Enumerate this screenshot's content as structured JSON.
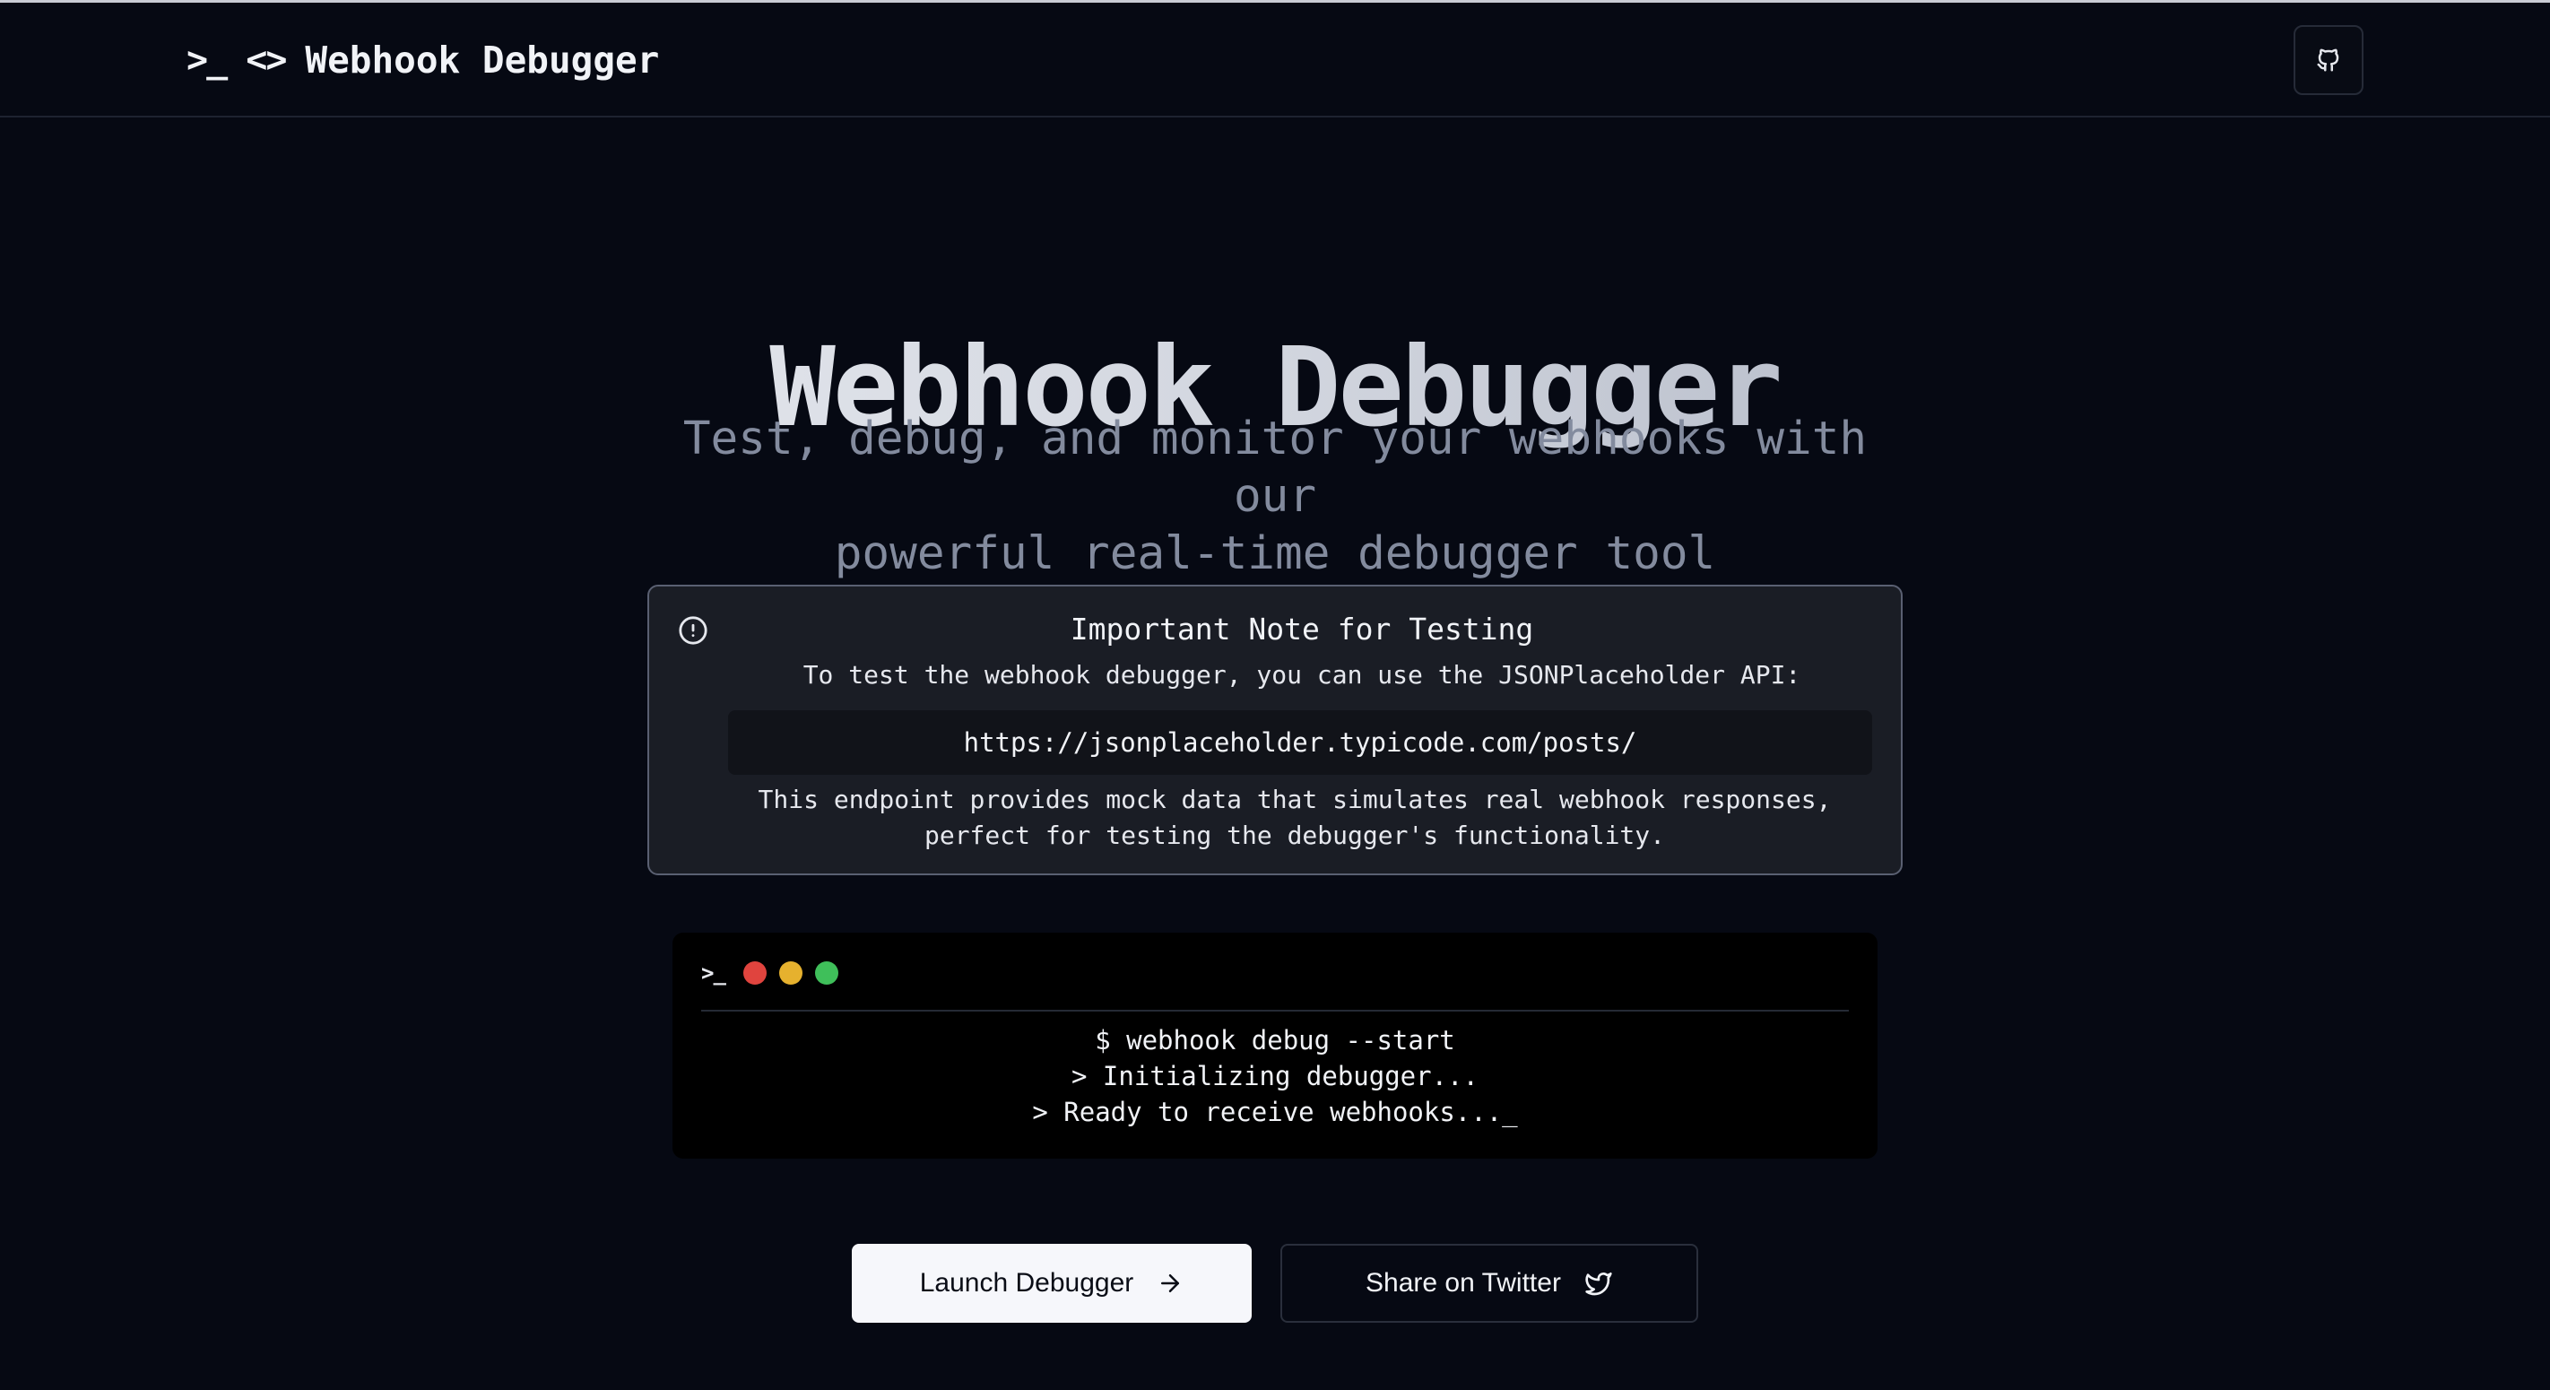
{
  "navbar": {
    "brand_icon": ">_ <>",
    "brand_title": "Webhook Debugger",
    "github_icon": "github-icon"
  },
  "hero": {
    "title": "Webhook Debugger",
    "subtitle_line1": "Test, debug, and monitor your webhooks with our",
    "subtitle_line2": "powerful real-time debugger tool"
  },
  "note": {
    "icon": "alert-circle-icon",
    "title": "Important Note for Testing",
    "description": "To test the webhook debugger, you can use the JSONPlaceholder API:",
    "url": "https://jsonplaceholder.typicode.com/posts/",
    "footer_line1": "This endpoint provides mock data that simulates real webhook responses,",
    "footer_line2": "perfect for testing the debugger's functionality."
  },
  "terminal": {
    "prompt_icon": ">_",
    "dot_colors": [
      "#e0443e",
      "#e6b12e",
      "#3fbf5a"
    ],
    "lines": [
      "$ webhook debug --start",
      "> Initializing debugger...",
      "> Ready to receive webhooks..._"
    ]
  },
  "buttons": {
    "launch_label": "Launch Debugger",
    "launch_icon": "arrow-right-icon",
    "share_label": "Share on Twitter",
    "share_icon": "twitter-icon"
  },
  "colors": {
    "background": "#060913",
    "accent_light": "#f6f7fb",
    "muted_text": "#838b9e"
  }
}
